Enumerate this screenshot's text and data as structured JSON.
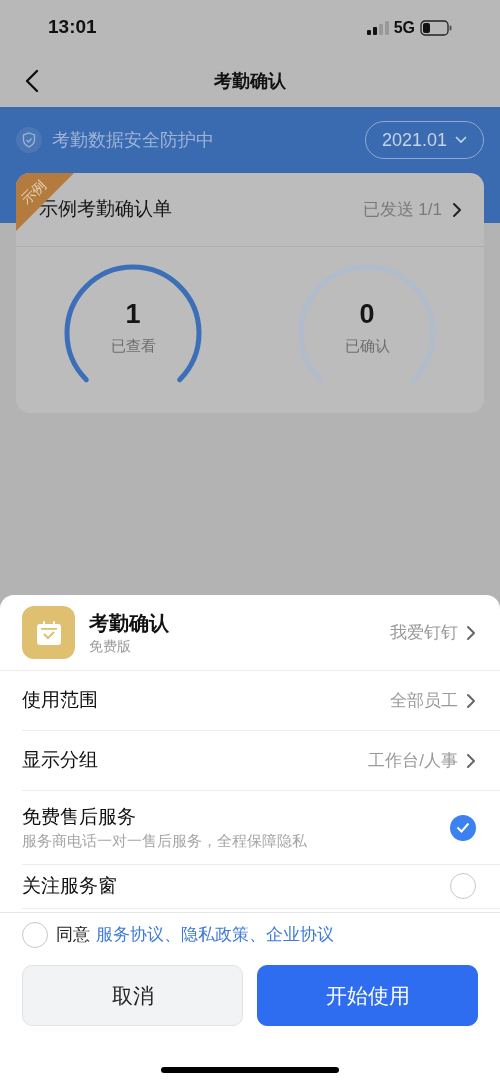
{
  "status_bar": {
    "time": "13:01",
    "network": "5G"
  },
  "nav": {
    "title": "考勤确认"
  },
  "banner": {
    "security_text": "考勤数据安全防护中",
    "month": "2021.01"
  },
  "card": {
    "badge": "示例",
    "title": "示例考勤确认单",
    "sent": "已发送 1/1",
    "gauges": [
      {
        "value": "1",
        "label": "已查看"
      },
      {
        "value": "0",
        "label": "已确认"
      }
    ]
  },
  "sheet": {
    "app": {
      "name": "考勤确认",
      "edition": "免费版",
      "vendor": "我爱钉钉"
    },
    "rows": [
      {
        "kind": "link",
        "label": "使用范围",
        "value": "全部员工"
      },
      {
        "kind": "link",
        "label": "显示分组",
        "value": "工作台/人事"
      },
      {
        "kind": "check",
        "label": "免费售后服务",
        "description": "服务商电话一对一售后服务，全程保障隐私",
        "checked": true
      },
      {
        "kind": "check",
        "label": "关注服务窗",
        "checked": false
      }
    ],
    "agreement": {
      "checked": false,
      "prefix": "同意",
      "links": "服务协议、隐私政策、企业协议"
    },
    "buttons": [
      {
        "kind": "secondary",
        "label": "取消"
      },
      {
        "kind": "primary",
        "label": "开始使用"
      }
    ]
  }
}
